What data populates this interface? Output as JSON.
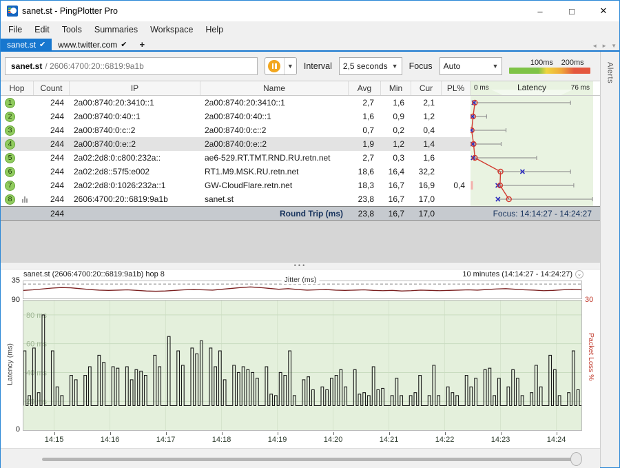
{
  "window": {
    "title": "sanet.st - PingPlotter Pro",
    "controls": {
      "minimize": "–",
      "maximize": "□",
      "close": "✕"
    }
  },
  "icons": {
    "pause": "❚❚",
    "dropdown": "▼",
    "check": "✔",
    "add_tab": "+",
    "tab_prev": "◄",
    "tab_next": "►",
    "tab_menu": "▼",
    "splitter_dots": "•••",
    "range_dropdown": "⌄"
  },
  "menu": {
    "items": [
      "File",
      "Edit",
      "Tools",
      "Summaries",
      "Workspace",
      "Help"
    ]
  },
  "tabs": {
    "items": [
      {
        "label": "www.twitter.com",
        "active": false
      },
      {
        "label": "sanet.st",
        "active": true
      }
    ]
  },
  "toolbar": {
    "target_host": "sanet.st",
    "target_rest": "/ 2606:4700:20::6819:9a1b",
    "interval_label": "Interval",
    "interval_value": "2,5 seconds",
    "focus_label": "Focus",
    "focus_value": "Auto",
    "legend": {
      "label_100": "100ms",
      "label_200": "200ms",
      "colors": [
        "#7fc347",
        "#eed53f",
        "#f0a93a",
        "#e4573f"
      ]
    }
  },
  "alerts_tab": {
    "label": "Alerts"
  },
  "table": {
    "headers": [
      "Hop",
      "Count",
      "IP",
      "Name",
      "Avg",
      "Min",
      "Cur",
      "PL%"
    ],
    "latency_header": {
      "left": "0 ms",
      "title": "Latency",
      "right": "76 ms"
    },
    "latency_scale_max": 76,
    "rows": [
      {
        "hop": "1",
        "count": "244",
        "ip": "2a00:8740:20:3410::1",
        "name": "2a00:8740:20:3410::1",
        "avg": "2,7",
        "min": "1,6",
        "cur": "2,1",
        "pl": "",
        "selected": false,
        "chart_icon": false,
        "graph": {
          "min": 1.6,
          "max": 62,
          "avg": 2.7,
          "cur": 2.1,
          "loss": false
        }
      },
      {
        "hop": "2",
        "count": "244",
        "ip": "2a00:8740:0:40::1",
        "name": "2a00:8740:0:40::1",
        "avg": "1,6",
        "min": "0,9",
        "cur": "1,2",
        "pl": "",
        "selected": false,
        "chart_icon": false,
        "graph": {
          "min": 0.9,
          "max": 10,
          "avg": 1.6,
          "cur": 1.2,
          "loss": false
        }
      },
      {
        "hop": "3",
        "count": "244",
        "ip": "2a00:8740:0:c::2",
        "name": "2a00:8740:0:c::2",
        "avg": "0,7",
        "min": "0,2",
        "cur": "0,4",
        "pl": "",
        "selected": false,
        "chart_icon": false,
        "graph": {
          "min": 0.2,
          "max": 22,
          "avg": 0.7,
          "cur": 0.4,
          "loss": false
        }
      },
      {
        "hop": "4",
        "count": "244",
        "ip": "2a00:8740:0:e::2",
        "name": "2a00:8740:0:e::2",
        "avg": "1,9",
        "min": "1,2",
        "cur": "1,4",
        "pl": "",
        "selected": true,
        "chart_icon": false,
        "graph": {
          "min": 1.2,
          "max": 19,
          "avg": 1.9,
          "cur": 1.4,
          "loss": false
        }
      },
      {
        "hop": "5",
        "count": "244",
        "ip": "2a02:2d8:0:c800:232a::",
        "name": "ae6-529.RT.TMT.RND.RU.retn.net",
        "avg": "2,7",
        "min": "0,3",
        "cur": "1,6",
        "pl": "",
        "selected": false,
        "chart_icon": false,
        "graph": {
          "min": 0.3,
          "max": 41,
          "avg": 2.7,
          "cur": 1.6,
          "loss": false
        }
      },
      {
        "hop": "6",
        "count": "244",
        "ip": "2a02:2d8::57f5:e002",
        "name": "RT1.M9.MSK.RU.retn.net",
        "avg": "18,6",
        "min": "16,4",
        "cur": "32,2",
        "pl": "",
        "selected": false,
        "chart_icon": false,
        "graph": {
          "min": 16.4,
          "max": 62,
          "avg": 18.6,
          "cur": 32.2,
          "loss": false
        }
      },
      {
        "hop": "7",
        "count": "244",
        "ip": "2a02:2d8:0:1026:232a::1",
        "name": "GW-CloudFlare.retn.net",
        "avg": "18,3",
        "min": "16,7",
        "cur": "16,9",
        "pl": "0,4",
        "selected": false,
        "chart_icon": false,
        "graph": {
          "min": 16.7,
          "max": 64,
          "avg": 18.3,
          "cur": 16.9,
          "loss": true
        }
      },
      {
        "hop": "8",
        "count": "244",
        "ip": "2606:4700:20::6819:9a1b",
        "name": "sanet.st",
        "avg": "23,8",
        "min": "16,7",
        "cur": "17,0",
        "pl": "",
        "selected": false,
        "chart_icon": true,
        "graph": {
          "min": 16.7,
          "max": 76,
          "avg": 23.8,
          "cur": 17.0,
          "loss": false
        }
      }
    ],
    "summary": {
      "count": "244",
      "label": "Round Trip (ms)",
      "avg": "23,8",
      "min": "16,7",
      "cur": "17,0",
      "focus": "Focus: 14:14:27 - 14:24:27"
    }
  },
  "timeline": {
    "title": "sanet.st (2606:4700:20::6819:9a1b) hop 8",
    "range": "10 minutes (14:14:27 - 14:24:27)",
    "jitter_max": "35",
    "latency_max": "90",
    "zero": "0",
    "packet_loss_max": "30",
    "latency_axis_label": "Latency (ms)",
    "packet_loss_axis_label": "Packet Loss %"
  },
  "chart_data": [
    {
      "type": "line",
      "title": "Jitter (ms)",
      "ylim": [
        30,
        36
      ],
      "reference_line": 35,
      "legend_position": "top-center",
      "grid": false,
      "values": [
        32.8,
        33.0,
        33.3,
        33.6,
        33.8,
        33.7,
        33.4,
        33.1,
        32.9,
        32.8,
        32.9,
        33.0,
        32.8,
        32.6,
        32.5,
        32.6,
        32.8,
        33.0,
        33.1,
        33.0,
        32.9,
        33.2,
        33.5,
        33.8,
        34.0,
        33.8,
        33.5,
        33.2,
        33.4,
        33.1,
        32.9,
        33.0,
        33.1,
        32.9,
        32.8,
        32.9,
        33.0,
        32.8,
        32.7,
        32.8,
        32.6,
        32.7,
        32.9,
        32.8,
        32.7,
        32.8,
        32.9,
        33.0,
        32.9,
        33.1,
        33.3,
        33.4,
        33.2,
        33.0,
        32.9,
        32.7,
        32.8,
        33.0,
        33.2,
        33.0
      ]
    },
    {
      "type": "bar",
      "title": "Latency (ms)",
      "ylabel": "Latency (ms)",
      "ylim": [
        0,
        90
      ],
      "baseline": 17,
      "gridlines": [
        20,
        40,
        60,
        80
      ],
      "grid_label_suffix": " ms",
      "x_labels": [
        "14:15",
        "14:16",
        "14:17",
        "14:18",
        "14:19",
        "14:20",
        "14:21",
        "14:22",
        "14:23",
        "14:24"
      ],
      "x_start_offset_s": 33,
      "x_label_step_s": 60,
      "x_total_s": 600,
      "right_axis": {
        "label": "Packet Loss %",
        "max": 30
      },
      "values": [
        55,
        24,
        57,
        26,
        80,
        17,
        55,
        30,
        24,
        17,
        38,
        35,
        17,
        38,
        44,
        17,
        52,
        47,
        17,
        44,
        43,
        17,
        44,
        35,
        42,
        41,
        38,
        17,
        52,
        44,
        17,
        65,
        17,
        55,
        45,
        17,
        57,
        53,
        62,
        17,
        57,
        44,
        55,
        35,
        17,
        45,
        40,
        44,
        42,
        40,
        36,
        17,
        44,
        25,
        24,
        40,
        38,
        55,
        24,
        17,
        35,
        37,
        28,
        17,
        30,
        28,
        36,
        38,
        42,
        30,
        17,
        42,
        25,
        26,
        24,
        44,
        28,
        29,
        17,
        24,
        36,
        24,
        17,
        24,
        26,
        38,
        17,
        24,
        45,
        24,
        17,
        30,
        26,
        24,
        17,
        38,
        30,
        36,
        17,
        42,
        43,
        24,
        36,
        17,
        30,
        42,
        36,
        24,
        17,
        26,
        45,
        30,
        17,
        52,
        42,
        24,
        17,
        26,
        55,
        28
      ]
    }
  ]
}
